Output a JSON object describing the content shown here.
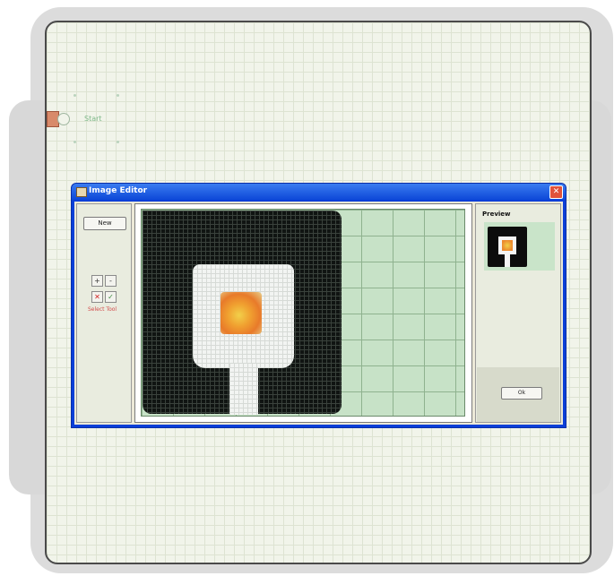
{
  "canvas": {
    "node_label": "Start"
  },
  "editor": {
    "title": "Image Editor",
    "close_label": "✕",
    "tools": {
      "new_label": "New",
      "zoom_in_label": "+",
      "zoom_out_label": "-",
      "delete_label": "✕",
      "apply_label": "✓",
      "caption": "Select Tool"
    },
    "preview": {
      "title": "Preview",
      "ok_label": "Ok"
    }
  },
  "colors": {
    "title_bar": "#0d48d8",
    "grid_background": "#c7e2c7",
    "pixel_dark": "#101412",
    "pixel_light": "#f2f4f2",
    "flame": "#f0a030"
  },
  "icons": [
    "image-editor-icon",
    "close-icon",
    "zoom-in-icon",
    "zoom-out-icon",
    "delete-icon",
    "checkmark-icon"
  ]
}
